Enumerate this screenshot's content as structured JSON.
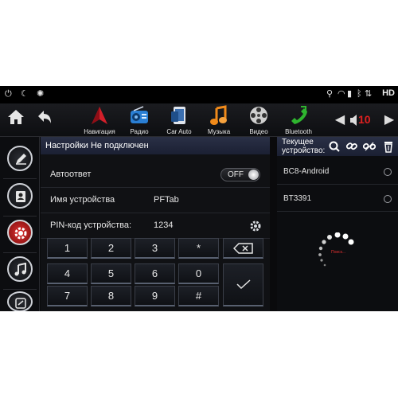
{
  "status": {
    "hd_label": "HD"
  },
  "nav": {
    "apps": [
      {
        "label": "Навигация",
        "icon": "navigation-icon",
        "color": "#d21f2a"
      },
      {
        "label": "Радио",
        "icon": "radio-icon",
        "color": "#2a7fd4"
      },
      {
        "label": "Car Auto",
        "icon": "car-auto-icon",
        "color": "#3b6fb0"
      },
      {
        "label": "Музыка",
        "icon": "music-icon",
        "color": "#f08a1a"
      },
      {
        "label": "Видео",
        "icon": "video-reel-icon",
        "color": "#b8b8b8"
      },
      {
        "label": "Bluetooth",
        "icon": "bluetooth-phone-icon",
        "color": "#2fb52f"
      }
    ],
    "volume": "10"
  },
  "main": {
    "header": "Настройки  Не подключен",
    "auto_answer_label": "Автоответ",
    "auto_answer_state": "OFF",
    "device_name_label": "Имя устройства",
    "device_name_value": "PFTab",
    "pin_label": "PIN-код устройства:",
    "pin_value": "1234",
    "keys": [
      "1",
      "2",
      "3",
      "*",
      "4",
      "5",
      "6",
      "0",
      "7",
      "8",
      "9",
      "#"
    ]
  },
  "right": {
    "title": "Текущее устройство:",
    "devices": [
      "BC8-Android",
      "BT3391"
    ],
    "spinner_text": "Поиск..."
  },
  "colors": {
    "accent": "#e02020",
    "header_bg": "#232a40"
  }
}
